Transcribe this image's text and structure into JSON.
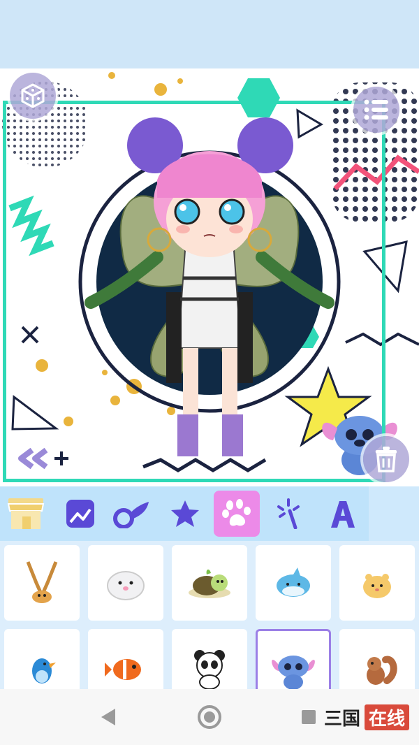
{
  "canvas": {
    "buttons": [
      {
        "name": "random-dice-button",
        "icon": "dice-icon"
      },
      {
        "name": "menu-list-button",
        "icon": "list-icon"
      },
      {
        "name": "delete-button",
        "icon": "trash-icon"
      },
      {
        "name": "collapse-add-button",
        "icon": "double-chevron-left-plus-icon"
      }
    ],
    "character": {
      "description_icon": "chibi-character"
    }
  },
  "toolbar": {
    "tools": [
      {
        "name": "tool-shop",
        "icon": "shop-icon",
        "active": false
      },
      {
        "name": "tool-background",
        "icon": "landscape-icon",
        "active": false
      },
      {
        "name": "tool-wings",
        "icon": "wing-icon",
        "active": false
      },
      {
        "name": "tool-stickers",
        "icon": "star-icon",
        "active": false
      },
      {
        "name": "tool-pets",
        "icon": "paw-icon",
        "active": true
      },
      {
        "name": "tool-effects",
        "icon": "magic-wand-icon",
        "active": false
      },
      {
        "name": "tool-text",
        "icon": "letter-a-icon",
        "active": false
      }
    ]
  },
  "pets": {
    "items": [
      {
        "name": "pet-fennec",
        "icon": "fennec-icon",
        "selected": false
      },
      {
        "name": "pet-seal",
        "icon": "seal-icon",
        "selected": false
      },
      {
        "name": "pet-turtle",
        "icon": "turtle-icon",
        "selected": false
      },
      {
        "name": "pet-shark",
        "icon": "shark-icon",
        "selected": false
      },
      {
        "name": "pet-hamster",
        "icon": "hamster-icon",
        "selected": false
      },
      {
        "name": "pet-bird",
        "icon": "bird-icon",
        "selected": false
      },
      {
        "name": "pet-clownfish",
        "icon": "clownfish-icon",
        "selected": false
      },
      {
        "name": "pet-panda",
        "icon": "panda-icon",
        "selected": false
      },
      {
        "name": "pet-stitch",
        "icon": "stitch-icon",
        "selected": true
      },
      {
        "name": "pet-squirrel",
        "icon": "squirrel-icon",
        "selected": false
      }
    ]
  },
  "watermark": {
    "part1": "三国",
    "part2": "在线"
  },
  "colors": {
    "frame": "#2fd9b6",
    "toolbar_bg": "#bfe3fb",
    "active_tool": "#ec8ae8",
    "icon_purple": "#5a49d6"
  }
}
